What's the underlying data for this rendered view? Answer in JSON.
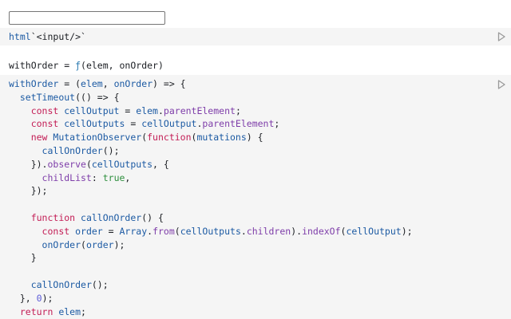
{
  "input": {
    "value": "",
    "placeholder": ""
  },
  "cell1": {
    "tag": "html",
    "template": "`<input/>`"
  },
  "output": {
    "name": "withOrder",
    "eq": " = ",
    "fsym": "ƒ",
    "sig": "(elem, onOrder)"
  },
  "cell2": {
    "lines": [
      [
        [
          "var",
          "withOrder"
        ],
        [
          "pl",
          " = ("
        ],
        [
          "var",
          "elem"
        ],
        [
          "pl",
          ", "
        ],
        [
          "var",
          "onOrder"
        ],
        [
          "pl",
          ") => {"
        ]
      ],
      [
        [
          "pl",
          "  "
        ],
        [
          "fn",
          "setTimeout"
        ],
        [
          "pl",
          "(() => {"
        ]
      ],
      [
        [
          "pl",
          "    "
        ],
        [
          "kw",
          "const "
        ],
        [
          "var",
          "cellOutput"
        ],
        [
          "pl",
          " = "
        ],
        [
          "var",
          "elem"
        ],
        [
          "pl",
          "."
        ],
        [
          "prop",
          "parentElement"
        ],
        [
          "pl",
          ";"
        ]
      ],
      [
        [
          "pl",
          "    "
        ],
        [
          "kw",
          "const "
        ],
        [
          "var",
          "cellOutputs"
        ],
        [
          "pl",
          " = "
        ],
        [
          "var",
          "cellOutput"
        ],
        [
          "pl",
          "."
        ],
        [
          "prop",
          "parentElement"
        ],
        [
          "pl",
          ";"
        ]
      ],
      [
        [
          "pl",
          "    "
        ],
        [
          "kw",
          "new "
        ],
        [
          "var",
          "MutationObserver"
        ],
        [
          "pl",
          "("
        ],
        [
          "kw",
          "function"
        ],
        [
          "pl",
          "("
        ],
        [
          "var",
          "mutations"
        ],
        [
          "pl",
          ") {"
        ]
      ],
      [
        [
          "pl",
          "      "
        ],
        [
          "var",
          "callOnOrder"
        ],
        [
          "pl",
          "();"
        ]
      ],
      [
        [
          "pl",
          "    })."
        ],
        [
          "prop",
          "observe"
        ],
        [
          "pl",
          "("
        ],
        [
          "var",
          "cellOutputs"
        ],
        [
          "pl",
          ", {"
        ]
      ],
      [
        [
          "pl",
          "      "
        ],
        [
          "prop",
          "childList"
        ],
        [
          "pl",
          ": "
        ],
        [
          "lit",
          "true"
        ],
        [
          "pl",
          ","
        ]
      ],
      [
        [
          "pl",
          "    });"
        ]
      ],
      [
        [
          "pl",
          " "
        ]
      ],
      [
        [
          "pl",
          "    "
        ],
        [
          "kw",
          "function "
        ],
        [
          "var",
          "callOnOrder"
        ],
        [
          "pl",
          "() {"
        ]
      ],
      [
        [
          "pl",
          "      "
        ],
        [
          "kw",
          "const "
        ],
        [
          "var",
          "order"
        ],
        [
          "pl",
          " = "
        ],
        [
          "var",
          "Array"
        ],
        [
          "pl",
          "."
        ],
        [
          "prop",
          "from"
        ],
        [
          "pl",
          "("
        ],
        [
          "var",
          "cellOutputs"
        ],
        [
          "pl",
          "."
        ],
        [
          "prop",
          "children"
        ],
        [
          "pl",
          ")."
        ],
        [
          "prop",
          "indexOf"
        ],
        [
          "pl",
          "("
        ],
        [
          "var",
          "cellOutput"
        ],
        [
          "pl",
          ");"
        ]
      ],
      [
        [
          "pl",
          "      "
        ],
        [
          "var",
          "onOrder"
        ],
        [
          "pl",
          "("
        ],
        [
          "var",
          "order"
        ],
        [
          "pl",
          ");"
        ]
      ],
      [
        [
          "pl",
          "    }"
        ]
      ],
      [
        [
          "pl",
          " "
        ]
      ],
      [
        [
          "pl",
          "    "
        ],
        [
          "var",
          "callOnOrder"
        ],
        [
          "pl",
          "();"
        ]
      ],
      [
        [
          "pl",
          "  }, "
        ],
        [
          "num",
          "0"
        ],
        [
          "pl",
          ");"
        ]
      ],
      [
        [
          "pl",
          "  "
        ],
        [
          "kw",
          "return "
        ],
        [
          "var",
          "elem"
        ],
        [
          "pl",
          ";"
        ]
      ]
    ]
  },
  "icons": {
    "run": "play-icon"
  },
  "colors": {
    "cell_bg": "#f5f5f5",
    "keyword": "#c31d55",
    "variable": "#1c5aa3",
    "property": "#7e3da9",
    "literal": "#2e8f3e",
    "number": "#5a5ad8"
  }
}
